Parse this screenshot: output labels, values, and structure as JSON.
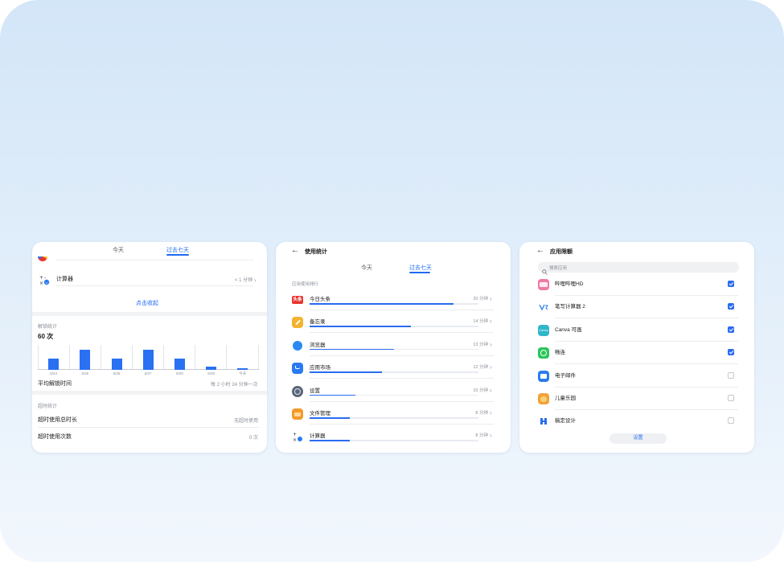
{
  "panel1": {
    "tabs": [
      "今天",
      "过去七天"
    ],
    "calculator_row": {
      "label": "计算器",
      "value": "< 1 分钟"
    },
    "collapse_link": "点击收起",
    "unlock": {
      "section_title": "解锁统计",
      "count": "60 次",
      "avg_label": "平均解锁时间",
      "avg_value": "每 2 小时 24 分钟一次"
    },
    "overtime": {
      "section_title": "超时统计",
      "rows": [
        {
          "label": "超时使用总时长",
          "value": "无超时使用"
        },
        {
          "label": "超时使用次数",
          "value": "0 次"
        }
      ]
    }
  },
  "chart_data": {
    "type": "bar",
    "title": "",
    "categories": [
      "6/24",
      "6/25",
      "6/26",
      "6/27",
      "6/28",
      "6/29",
      "今天"
    ],
    "values": [
      14,
      25,
      14,
      25,
      14,
      4,
      2
    ],
    "ylim": [
      0,
      28
    ],
    "xlabel": "",
    "ylabel": "",
    "color": "#2a70f2",
    "grid": "vertical"
  },
  "panel2": {
    "title": "使用统计",
    "tabs": [
      "今天",
      "过去七天"
    ],
    "section_title": "应用使用排行",
    "apps": [
      {
        "name": "今日头条",
        "time": "20 分钟",
        "fraction": 0.85,
        "icon": "toutiao-icon",
        "color": "#e8352e",
        "icon_text": "头条"
      },
      {
        "name": "备忘录",
        "time": "14 分钟",
        "fraction": 0.6,
        "icon": "notepad-icon",
        "color": "#f4b32e",
        "icon_text": ""
      },
      {
        "name": "浏览器",
        "time": "13 分钟",
        "fraction": 0.5,
        "icon": "browser-icon",
        "color": "#2a8af2",
        "icon_text": ""
      },
      {
        "name": "应用市场",
        "time": "12 分钟",
        "fraction": 0.43,
        "icon": "app-market-icon",
        "color": "#2a7bf0",
        "icon_text": ""
      },
      {
        "name": "设置",
        "time": "10 分钟",
        "fraction": 0.27,
        "icon": "settings-icon",
        "color": "#5a6678",
        "icon_text": ""
      },
      {
        "name": "文件管理",
        "time": "8 分钟",
        "fraction": 0.24,
        "icon": "file-manager-icon",
        "color": "#f39a2a",
        "icon_text": ""
      },
      {
        "name": "计算器",
        "time": "8 分钟",
        "fraction": 0.24,
        "icon": "calculator-icon",
        "color": "#ffffff",
        "icon_text": ""
      }
    ]
  },
  "panel3": {
    "title": "应用限额",
    "search_placeholder": "搜索应用",
    "apps": [
      {
        "name": "哔哩哔哩HD",
        "checked": true,
        "icon": "bilibili-icon",
        "color": "#f07aa6"
      },
      {
        "name": "笔写计算器 2",
        "checked": true,
        "icon": "handwriting-calculator-icon",
        "color": "#ffffff"
      },
      {
        "name": "Canva 可画",
        "checked": true,
        "icon": "canva-icon",
        "color": "#2fb6c9"
      },
      {
        "name": "畅连",
        "checked": true,
        "icon": "changlian-icon",
        "color": "#2bc55c"
      },
      {
        "name": "电子邮件",
        "checked": false,
        "icon": "email-icon",
        "color": "#2a7bf0"
      },
      {
        "name": "儿童乐园",
        "checked": false,
        "icon": "kids-park-icon",
        "color": "#f2a33a"
      },
      {
        "name": "稿定设计",
        "checked": false,
        "icon": "gaoding-icon",
        "color": "#ffffff"
      }
    ],
    "settings_button": "设置"
  }
}
